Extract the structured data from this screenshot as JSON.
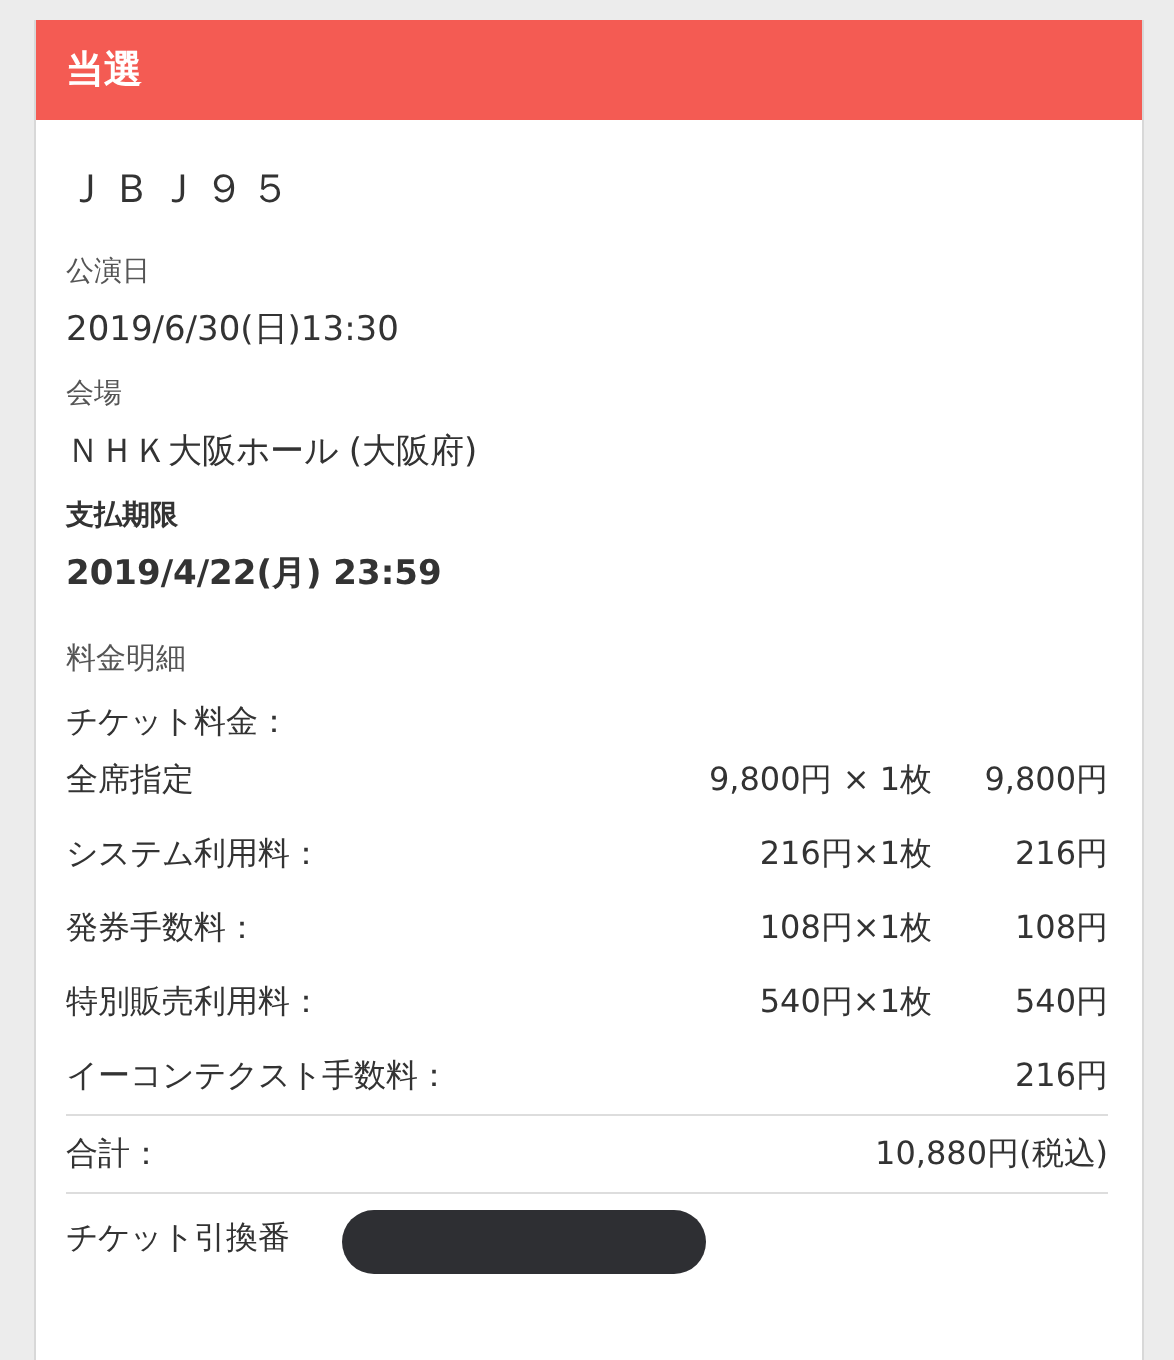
{
  "status": "当選",
  "code": "ＪＢＪ９５",
  "fields": [
    {
      "label": "公演日",
      "value": "2019/6/30(日)13:30",
      "emphasis": false
    },
    {
      "label": "会場",
      "value": "ＮＨＫ大阪ホール (大阪府)",
      "emphasis": false
    },
    {
      "label": "支払期限",
      "value": "2019/4/22(月) 23:59",
      "emphasis": true
    }
  ],
  "breakdown": {
    "title": "料金明細",
    "subtitle": "チケット料金：",
    "items": [
      {
        "label": "全席指定",
        "quantity": "9,800円 × 1枚",
        "amount": "9,800円"
      },
      {
        "label": "システム利用料：",
        "quantity": "216円×1枚",
        "amount": "216円"
      },
      {
        "label": "発券手数料：",
        "quantity": "108円×1枚",
        "amount": "108円"
      },
      {
        "label": "特別販売利用料：",
        "quantity": "540円×1枚",
        "amount": "540円"
      },
      {
        "label": "イーコンテクスト手数料：",
        "amount": "216円"
      }
    ]
  },
  "total": {
    "label": "合計：",
    "amount": "10,880円(税込)"
  },
  "ticket_number": {
    "label": "チケット引換番"
  }
}
